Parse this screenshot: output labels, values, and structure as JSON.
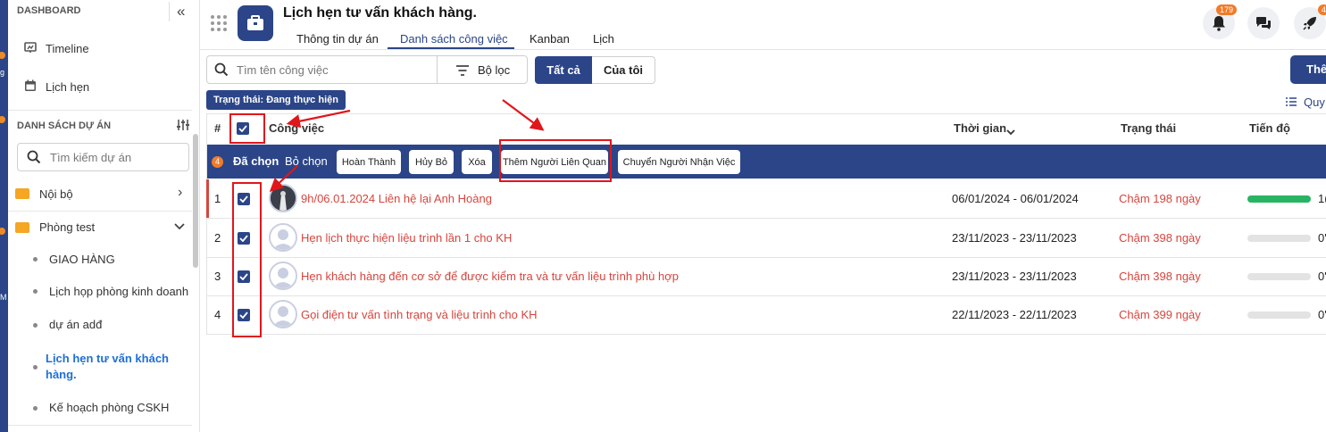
{
  "sidebar": {
    "dashboard": "DASHBOARD",
    "timeline": "Timeline",
    "lich_hen": "Lịch hẹn",
    "projects_heading": "DANH SÁCH DỰ ÁN",
    "search_placeholder": "Tìm kiếm dự án",
    "folders": [
      {
        "label": "Nội bộ"
      },
      {
        "label": "Phòng test"
      }
    ],
    "projects": [
      {
        "label": "GIAO HÀNG"
      },
      {
        "label": "Lịch họp phòng kinh doanh"
      },
      {
        "label": "dự án adđ"
      },
      {
        "label": "Lịch hẹn tư vấn khách hàng."
      },
      {
        "label": "Kế hoạch phòng CSKH"
      }
    ],
    "strip_letters": [
      "g",
      "M"
    ]
  },
  "header": {
    "title": "Lịch hẹn tư vấn khách hàng.",
    "tabs": [
      "Thông tin dự án",
      "Danh sách công việc",
      "Kanban",
      "Lịch"
    ],
    "active_tab": "Danh sách công việc",
    "notification_count": "179",
    "rocket_badge": "4"
  },
  "toolbar": {
    "search_placeholder": "Tìm tên công việc",
    "filter_label": "Bộ lọc",
    "seg_all": "Tất cả",
    "seg_mine": "Của tôi",
    "add_label": "Thê",
    "status_chip": "Trạng thái: Đang thực hiện",
    "sort_label": "Quy"
  },
  "table": {
    "col_index": "#",
    "col_task": "Công việc",
    "col_time": "Thời gian",
    "col_status": "Trạng thái",
    "col_progress": "Tiến độ",
    "selection": {
      "count": "4",
      "selected_label": "Đã chọn",
      "deselect_label": "Bỏ chọn",
      "actions": [
        "Hoàn Thành",
        "Hủy Bỏ",
        "Xóa",
        "Thêm Người Liên Quan",
        "Chuyển Người Nhận Việc"
      ]
    },
    "rows": [
      {
        "index": "1",
        "task": "9h/06.01.2024 Liên hệ lại Anh Hoàng",
        "time": "06/01/2024 - 06/01/2024",
        "status": "Chậm 198 ngày",
        "progress": 100,
        "progress_label": "1("
      },
      {
        "index": "2",
        "task": "Hẹn lịch thực hiện liệu trình lần 1 cho KH",
        "time": "23/11/2023 - 23/11/2023",
        "status": "Chậm 398 ngày",
        "progress": 0,
        "progress_label": "0'"
      },
      {
        "index": "3",
        "task": "Hẹn khách hàng đến cơ sở để được kiểm tra và tư vấn liệu trình phù hợp",
        "time": "23/11/2023 - 23/11/2023",
        "status": "Chậm 398 ngày",
        "progress": 0,
        "progress_label": "0'"
      },
      {
        "index": "4",
        "task": "Gọi điện tư vấn tình trạng và liệu trình cho KH",
        "time": "22/11/2023 - 22/11/2023",
        "status": "Chậm 399 ngày",
        "progress": 0,
        "progress_label": "0'"
      }
    ]
  },
  "colors": {
    "primary": "#2b4588",
    "danger_text": "#d6453d",
    "progress_green": "#28b463",
    "annotation_red": "#e0161b",
    "badge_orange": "#f07c2a"
  }
}
